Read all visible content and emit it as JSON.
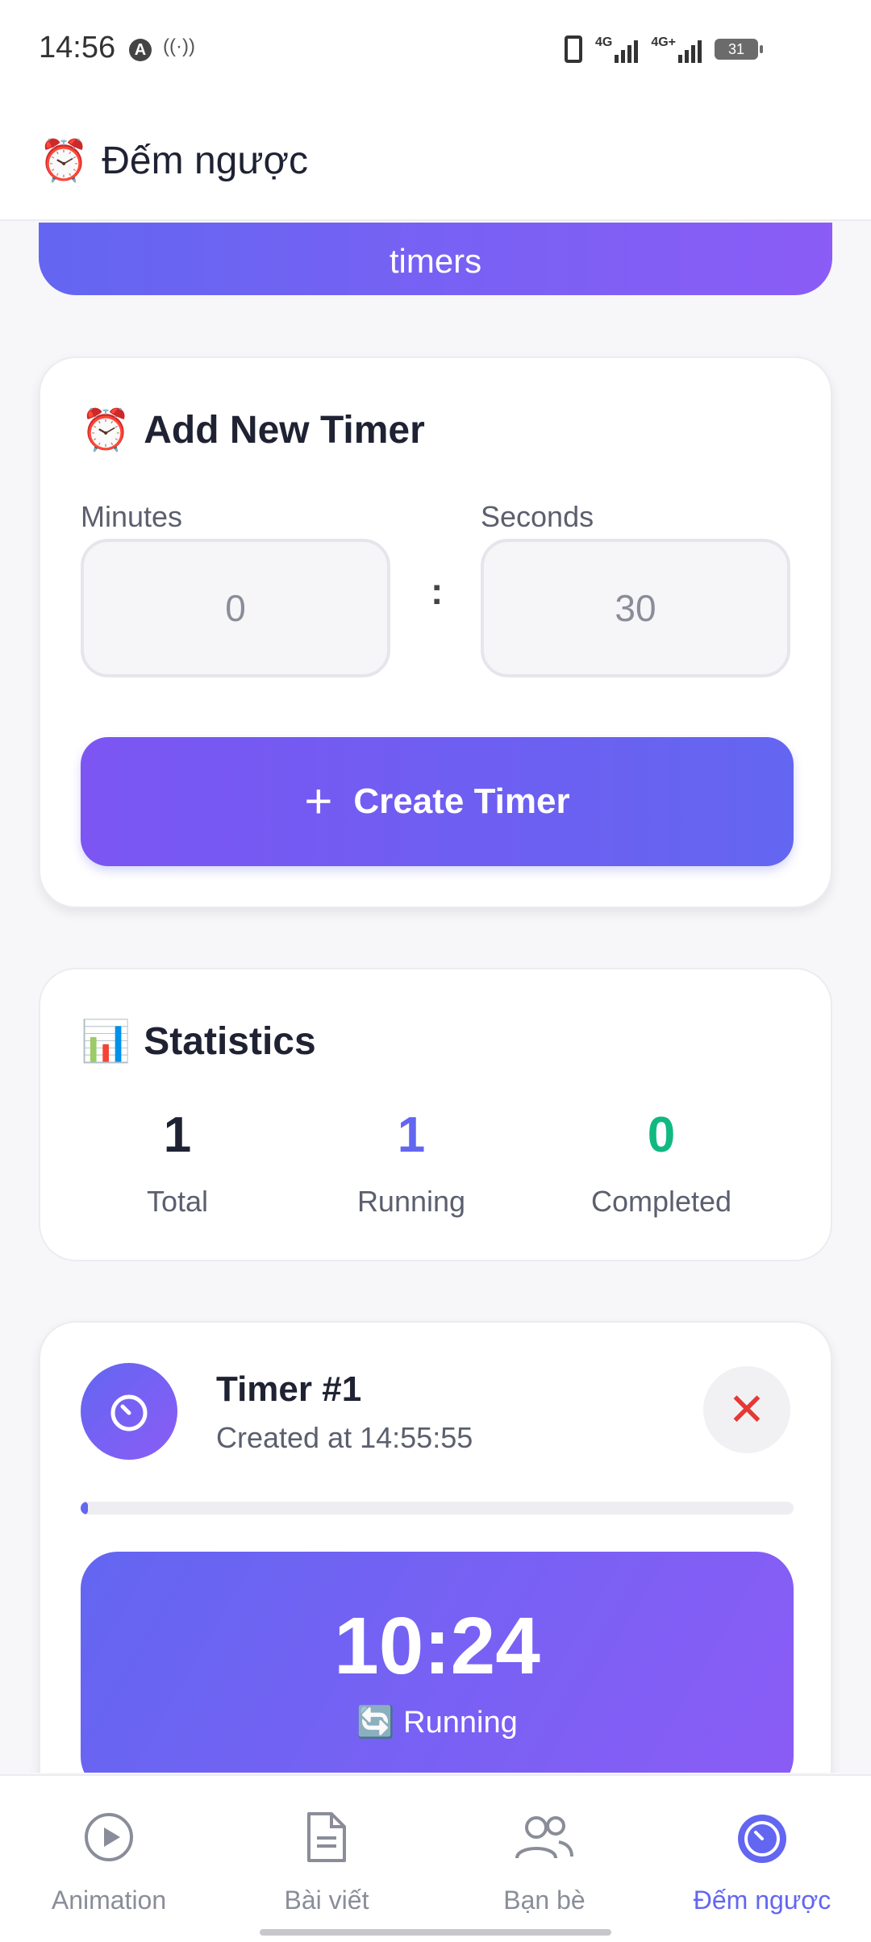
{
  "status_bar": {
    "time": "14:56",
    "network_1": "4G",
    "network_2": "4G+",
    "battery": "31"
  },
  "header": {
    "icon": "alarm-clock-icon",
    "title": "Đếm ngược"
  },
  "hero": {
    "text": "timers"
  },
  "add_timer": {
    "title": "Add New Timer",
    "minutes_label": "Minutes",
    "seconds_label": "Seconds",
    "minutes_value": "0",
    "seconds_value": "30",
    "separator": ":",
    "create_label": "Create Timer"
  },
  "statistics": {
    "title": "Statistics",
    "total": "1",
    "total_label": "Total",
    "running": "1",
    "running_label": "Running",
    "completed": "0",
    "completed_label": "Completed",
    "colors": {
      "total": "#1f2233",
      "running": "#6366f1",
      "completed": "#10b981"
    }
  },
  "timer": {
    "name": "Timer #1",
    "created": "Created at 14:55:55",
    "time": "10:24",
    "status": "Running",
    "progress": 0.01
  },
  "nav": {
    "items": [
      {
        "label": "Animation",
        "icon": "play-circle-icon"
      },
      {
        "label": "Bài viết",
        "icon": "document-icon"
      },
      {
        "label": "Bạn bè",
        "icon": "users-icon"
      },
      {
        "label": "Đếm ngược",
        "icon": "timer-icon",
        "active": true
      }
    ]
  },
  "colors": {
    "accent": "#6366f1",
    "accent_2": "#8b5cf6",
    "danger": "#e53935"
  }
}
